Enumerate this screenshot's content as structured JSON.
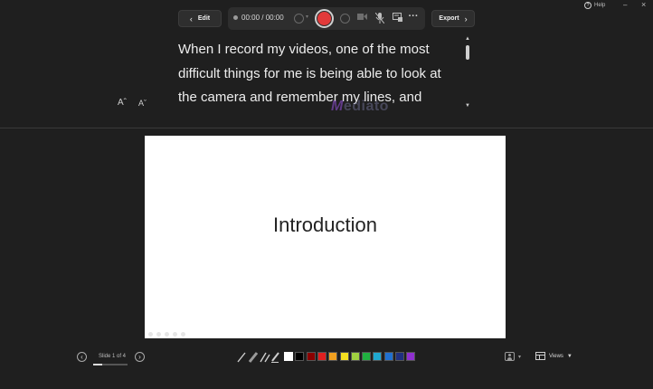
{
  "window": {
    "help_label": "Help",
    "minimize_label": "–",
    "close_label": "×"
  },
  "toolbar": {
    "edit_label": "Edit",
    "time_display": "00:00 / 00:00",
    "export_label": "Export"
  },
  "script": {
    "text": "When I record my videos, one of the most difficult things for me is being able to look at the camera and remember my lines, and",
    "font_increase_label": "Aˆ",
    "font_decrease_label": "Aˇ"
  },
  "watermark": {
    "text": "ediato"
  },
  "slide": {
    "title": "Introduction"
  },
  "footer": {
    "slide_counter": "Slide 1 of 4",
    "views_label": "Views",
    "colors": [
      "#ffffff",
      "#000000",
      "#8b0000",
      "#e02020",
      "#f0a020",
      "#f5e020",
      "#a0d040",
      "#20b040",
      "#20a8d0",
      "#2070d0",
      "#203080",
      "#9030d0"
    ],
    "progress": 0.25
  }
}
